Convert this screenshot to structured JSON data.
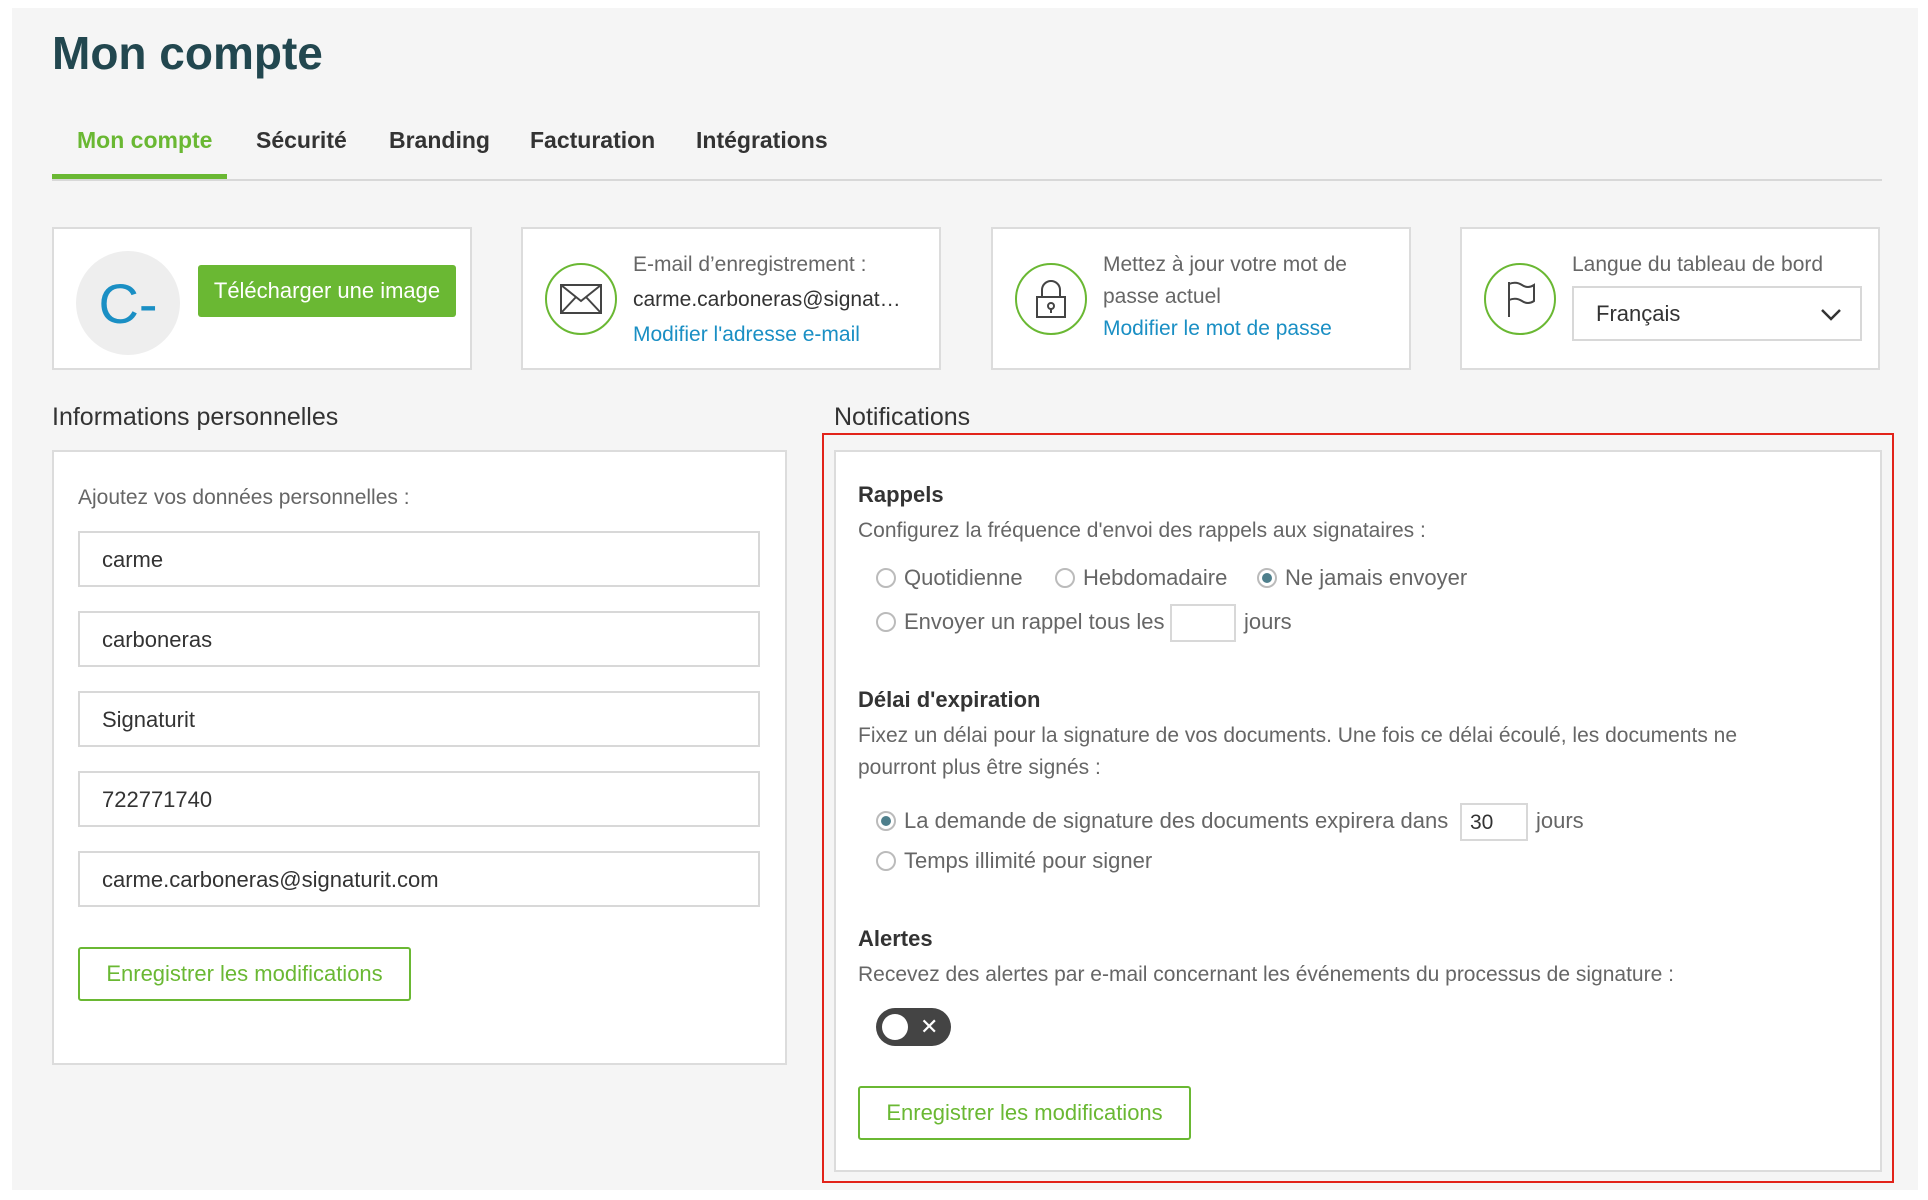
{
  "page": {
    "title": "Mon compte"
  },
  "tabs": [
    {
      "label": "Mon compte",
      "active": true
    },
    {
      "label": "Sécurité"
    },
    {
      "label": "Branding"
    },
    {
      "label": "Facturation"
    },
    {
      "label": "Intégrations"
    }
  ],
  "cards": {
    "avatar": {
      "initials": "C-",
      "upload_label": "Télécharger une image"
    },
    "email": {
      "label": "E-mail d’enregistrement :",
      "value": "carme.carboneras@signat…",
      "link": "Modifier l'adresse e-mail",
      "icon": "envelope-icon"
    },
    "password": {
      "line1": "Mettez à jour votre mot de",
      "line2": "passe actuel",
      "link": "Modifier le mot de passe",
      "icon": "lock-icon"
    },
    "language": {
      "label": "Langue du tableau de bord",
      "selected": "Français",
      "icon": "flag-icon"
    }
  },
  "personal": {
    "title": "Informations personnelles",
    "intro": "Ajoutez vos données personnelles :",
    "fields": [
      "carme",
      "carboneras",
      "Signaturit",
      "722771740",
      "carme.carboneras@signaturit.com"
    ],
    "save_label": "Enregistrer les modifications"
  },
  "notifications": {
    "title": "Notifications",
    "reminders": {
      "heading": "Rappels",
      "desc": "Configurez la fréquence d'envoi des rappels aux signataires :",
      "options": [
        "Quotidienne",
        "Hebdomadaire",
        "Ne jamais envoyer"
      ],
      "selected": "Ne jamais envoyer",
      "custom_prefix": "Envoyer un rappel tous les",
      "custom_value": "",
      "custom_suffix": "jours"
    },
    "expiration": {
      "heading": "Délai d'expiration",
      "desc_line1": "Fixez un délai pour la signature de vos documents. Une fois ce délai écoulé, les documents ne",
      "desc_line2": "pourront plus être signés :",
      "option1_prefix": "La demande de signature des documents expirera dans",
      "option1_value": "30",
      "option1_suffix": "jours",
      "option2": "Temps illimité pour signer",
      "selected": "option1"
    },
    "alerts": {
      "heading": "Alertes",
      "desc": "Recevez des alertes par e-mail concernant les événements du processus de signature :",
      "toggle_on": false
    },
    "save_label": "Enregistrer les modifications"
  },
  "colors": {
    "brand_green": "#6ab833",
    "link_blue": "#1a8fc4",
    "title": "#22474f",
    "highlight": "#e2231a"
  }
}
